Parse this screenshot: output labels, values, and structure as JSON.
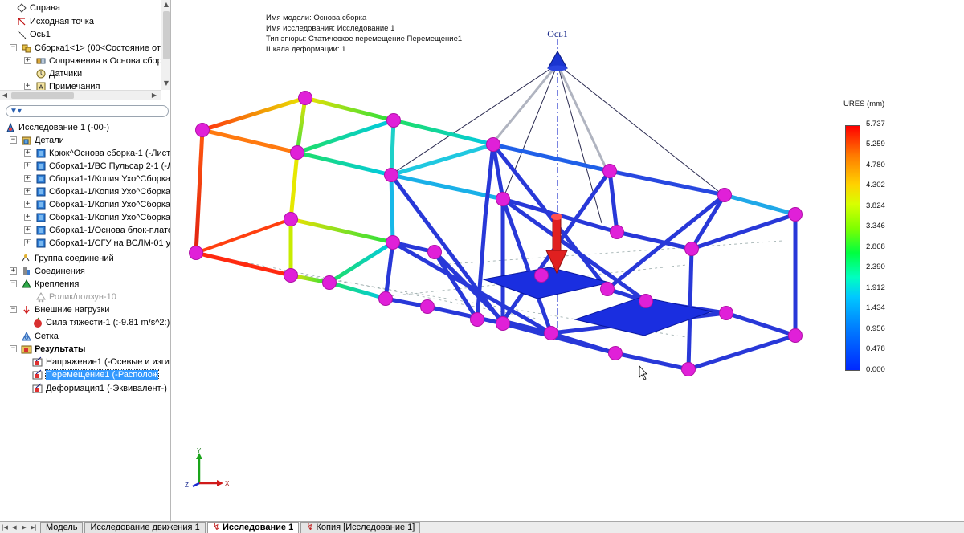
{
  "feature_tree": {
    "rows": [
      {
        "label": "Справа",
        "icon": "plane-icon"
      },
      {
        "label": "Исходная точка",
        "icon": "origin-icon"
      },
      {
        "label": "Ось1",
        "icon": "axis-icon"
      },
      {
        "label": "Сборка1<1> (00<Состояние от",
        "icon": "assembly-icon"
      },
      {
        "label": "Сопряжения в Основа сбор",
        "icon": "mates-icon"
      },
      {
        "label": "Датчики",
        "icon": "sensor-icon"
      },
      {
        "label": "Примечания",
        "icon": "annotation-icon"
      }
    ]
  },
  "study_tree": {
    "root": "Исследование 1 (-00-)",
    "parts_folder": "Детали",
    "parts": [
      "Крюк^Основа сборка-1 (-Лист",
      "Сборка1-1/ВС Пульсар 2-1 (-Л",
      "Сборка1-1/Копия Ухо^Сборка",
      "Сборка1-1/Копия Ухо^Сборка",
      "Сборка1-1/Копия Ухо^Сборка",
      "Сборка1-1/Копия Ухо^Сборка",
      "Сборка1-1/Основа блок-плато",
      "Сборка1-1/СГУ на ВСЛМ-01 уг"
    ],
    "connection_groups": "Группа соединений",
    "connections": "Соединения",
    "fixtures": "Крепления",
    "fixture_item": "Ролик/ползун-10",
    "external_loads": "Внешние нагрузки",
    "gravity": "Сила тяжести-1 (:-9.81 m/s^2:)",
    "mesh": "Сетка",
    "results": "Результаты",
    "result_items": [
      "Напряжение1 (-Осевые и изги",
      "Перемещение1 (-Располож",
      "Деформация1 (-Эквивалент-)"
    ]
  },
  "bottom_tabs": [
    "Модель",
    "Исследование движения 1",
    "Исследование 1",
    "Копия [Исследование 1]"
  ],
  "active_tab": "Исследование 1",
  "info_lines": [
    "Имя модели: Основа сборка",
    "Имя  исследования: Исследование 1",
    "Тип эпюры: Статическое перемещение Перемещение1",
    "Шкала деформации: 1"
  ],
  "axis_label": "Ось1",
  "legend": {
    "title": "URES (mm)",
    "values": [
      "5.737",
      "5.259",
      "4.780",
      "4.302",
      "3.824",
      "3.346",
      "2.868",
      "2.390",
      "1.912",
      "1.434",
      "0.956",
      "0.478",
      "0.000"
    ]
  },
  "triad": {
    "y": "Y",
    "z": "Z",
    "x": "X"
  }
}
